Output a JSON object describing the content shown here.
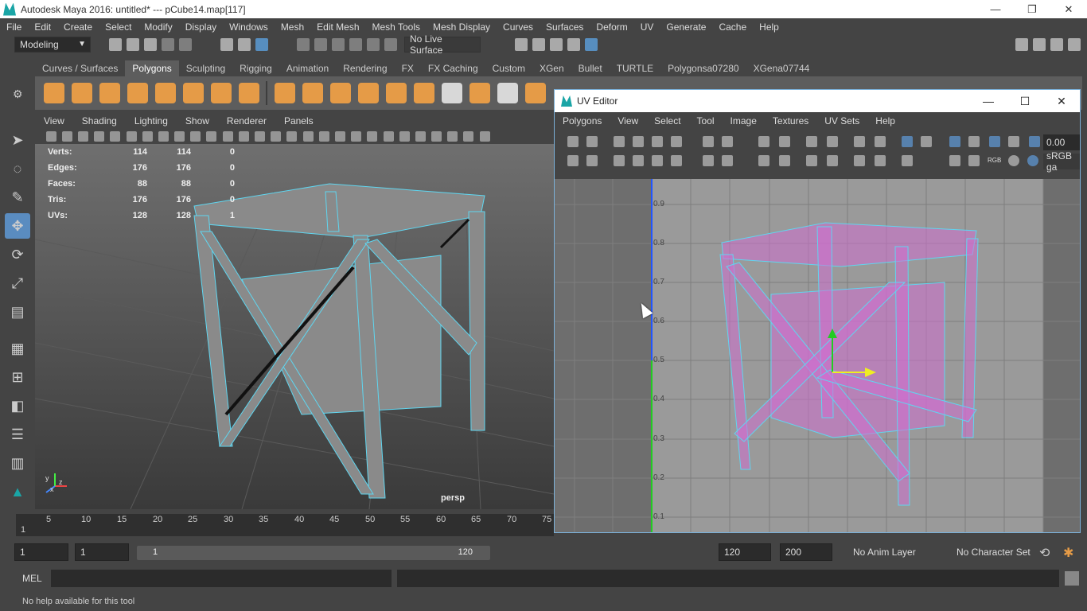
{
  "window": {
    "title": "Autodesk Maya 2016: untitled*   ---   pCube14.map[117]"
  },
  "menubar": [
    "File",
    "Edit",
    "Create",
    "Select",
    "Modify",
    "Display",
    "Windows",
    "Mesh",
    "Edit Mesh",
    "Mesh Tools",
    "Mesh Display",
    "Curves",
    "Surfaces",
    "Deform",
    "UV",
    "Generate",
    "Cache",
    "Help"
  ],
  "statusline": {
    "mode": "Modeling",
    "live_surface": "No Live Surface"
  },
  "shelf_tabs": [
    "Curves / Surfaces",
    "Polygons",
    "Sculpting",
    "Rigging",
    "Animation",
    "Rendering",
    "FX",
    "FX Caching",
    "Custom",
    "XGen",
    "Bullet",
    "TURTLE",
    "Polygonsa07280",
    "XGena07744"
  ],
  "active_shelf_tab": "Polygons",
  "viewport": {
    "menu": [
      "View",
      "Shading",
      "Lighting",
      "Show",
      "Renderer",
      "Panels"
    ],
    "camera": "persp",
    "hud": [
      {
        "label": "Verts:",
        "a": "114",
        "b": "114",
        "c": "0"
      },
      {
        "label": "Edges:",
        "a": "176",
        "b": "176",
        "c": "0"
      },
      {
        "label": "Faces:",
        "a": "88",
        "b": "88",
        "c": "0"
      },
      {
        "label": "Tris:",
        "a": "176",
        "b": "176",
        "c": "0"
      },
      {
        "label": "UVs:",
        "a": "128",
        "b": "128",
        "c": "1"
      }
    ],
    "axis_labels": {
      "x": "x",
      "y": "y",
      "z": "z"
    }
  },
  "uv_editor": {
    "title": "UV Editor",
    "menu": [
      "Polygons",
      "View",
      "Select",
      "Tool",
      "Image",
      "Textures",
      "UV Sets",
      "Help"
    ],
    "value_field": "0.00",
    "color_space": "sRGB ga",
    "rgb_label": "RGB",
    "v_labels": [
      "0.9",
      "0.8",
      "0.7",
      "0.6",
      "0.5",
      "0.4",
      "0.3",
      "0.2",
      "0.1"
    ]
  },
  "timeline": {
    "ticks": [
      "1",
      "5",
      "10",
      "15",
      "20",
      "25",
      "30",
      "35",
      "40",
      "45",
      "50",
      "55",
      "60",
      "65",
      "70",
      "75"
    ]
  },
  "range": {
    "start": "1",
    "current": "1",
    "inner_start": "1",
    "inner_end": "120",
    "end": "120",
    "max_end": "200",
    "anim_layer": "No Anim Layer",
    "character_set": "No Character Set"
  },
  "command": {
    "lang": "MEL"
  },
  "help_line": "No help available for this tool",
  "colors": {
    "accent": "#5a8cc0",
    "shelf_icon": "#e59b47",
    "uv_shell": "#d070d0",
    "wire": "#5fd6f0"
  }
}
